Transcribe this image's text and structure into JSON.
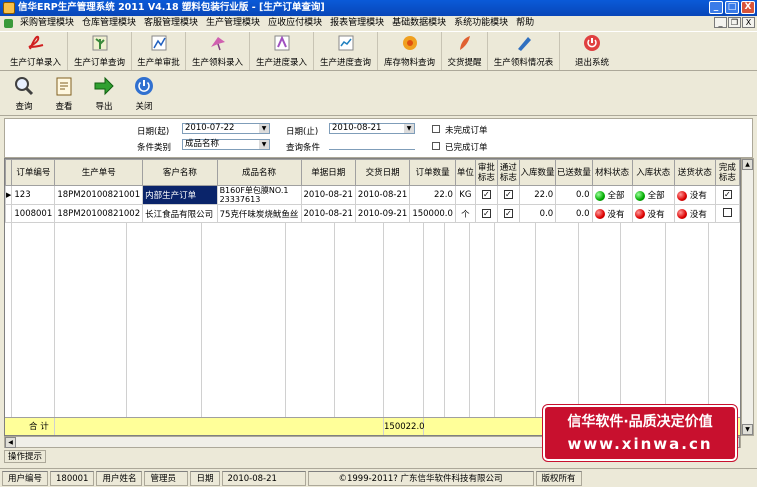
{
  "window": {
    "title": "信华ERP生产管理系统  2011 V4.18  塑料包装行业版 - [生产订单查询]",
    "min": "_",
    "max": "□",
    "close": "X"
  },
  "mdi": {
    "min": "_",
    "restore": "❐",
    "close": "X"
  },
  "menu": [
    "采购管理模块",
    "仓库管理模块",
    "客服管理模块",
    "生产管理模块",
    "应收应付模块",
    "报表管理模块",
    "基础数据模块",
    "系统功能模块",
    "帮助"
  ],
  "toolbar1": [
    {
      "label": "生产订单录入",
      "icon": "pdf-icon",
      "color": "#d02020"
    },
    {
      "label": "生产订单查询",
      "icon": "plant-icon",
      "color": "#3a8a3a"
    },
    {
      "label": "生产单审批",
      "icon": "chart-icon",
      "color": "#2060c0"
    },
    {
      "label": "生产领料录入",
      "icon": "bird-icon",
      "color": "#c040a0"
    },
    {
      "label": "生产进度录入",
      "icon": "progress-icon",
      "color": "#a050c0"
    },
    {
      "label": "生产进度查询",
      "icon": "graph-icon",
      "color": "#2080c0"
    },
    {
      "label": "库存物料查询",
      "icon": "flower-icon",
      "color": "#e09020"
    },
    {
      "label": "交货提醒",
      "icon": "feather-icon",
      "color": "#e05020"
    },
    {
      "label": "生产领料情况表",
      "icon": "pen-icon",
      "color": "#2050a0"
    },
    {
      "label": "退出系统",
      "icon": "power-icon",
      "color": "#e03030"
    }
  ],
  "toolbar2": [
    {
      "label": "查询",
      "icon": "magnifier-icon"
    },
    {
      "label": "查看",
      "icon": "document-icon"
    },
    {
      "label": "导出",
      "icon": "arrow-right-icon"
    },
    {
      "label": "关闭",
      "icon": "power-icon"
    }
  ],
  "filter": {
    "date_start_label": "日期(起)",
    "date_start": "2010-07-22",
    "date_end_label": "日期(止)",
    "date_end": "2010-08-21",
    "category_label": "条件类别",
    "category": "成品名称",
    "query_label": "查询条件",
    "query": "",
    "unfinished": "未完成订单",
    "finished": "已完成订单"
  },
  "grid": {
    "headers": [
      "订单编号",
      "生产单号",
      "客户名称",
      "成品名称",
      "单据日期",
      "交货日期",
      "订单数量",
      "单位",
      "审批标志",
      "通过标志",
      "入库数量",
      "已送数量",
      "材料状态",
      "入库状态",
      "送货状态",
      "完成标志"
    ],
    "rows": [
      {
        "order": "123",
        "prod": "18PM20100821001",
        "customer": "内部生产订单",
        "product": "B160F单包膜NO.1 23337613",
        "date": "2010-08-21",
        "delivery": "2010-08-21",
        "qty": "22.0",
        "unit": "KG",
        "approved": true,
        "passed": true,
        "instock": "22.0",
        "sent": "0.0",
        "mat": "全部",
        "matc": "g",
        "stock": "全部",
        "stockc": "g",
        "ship": "没有",
        "shipc": "r",
        "done": true
      },
      {
        "order": "1008001",
        "prod": "18PM20100821002",
        "customer": "长江食品有限公司",
        "product": "75克仟味炭烧鱿鱼丝",
        "date": "2010-08-21",
        "delivery": "2010-09-21",
        "qty": "150000.0",
        "unit": "个",
        "approved": true,
        "passed": true,
        "instock": "0.0",
        "sent": "0.0",
        "mat": "没有",
        "matc": "r",
        "stock": "没有",
        "stockc": "r",
        "ship": "没有",
        "shipc": "r",
        "done": false
      }
    ],
    "sum_label": "合 计",
    "sum_qty": "150022.0"
  },
  "promo": {
    "line1": "信华软件·品质决定价值",
    "line2": "www.xinwa.cn"
  },
  "tips": "操作提示",
  "status": {
    "user_no_label": "用户编号",
    "user_no": "180001",
    "user_name_label": "用户姓名",
    "user_name": "管理员",
    "date_label": "日期",
    "date": "2010-08-21",
    "copyright": "©1999-2011? 广东信华软件科技有限公司",
    "rights": "版权所有"
  }
}
